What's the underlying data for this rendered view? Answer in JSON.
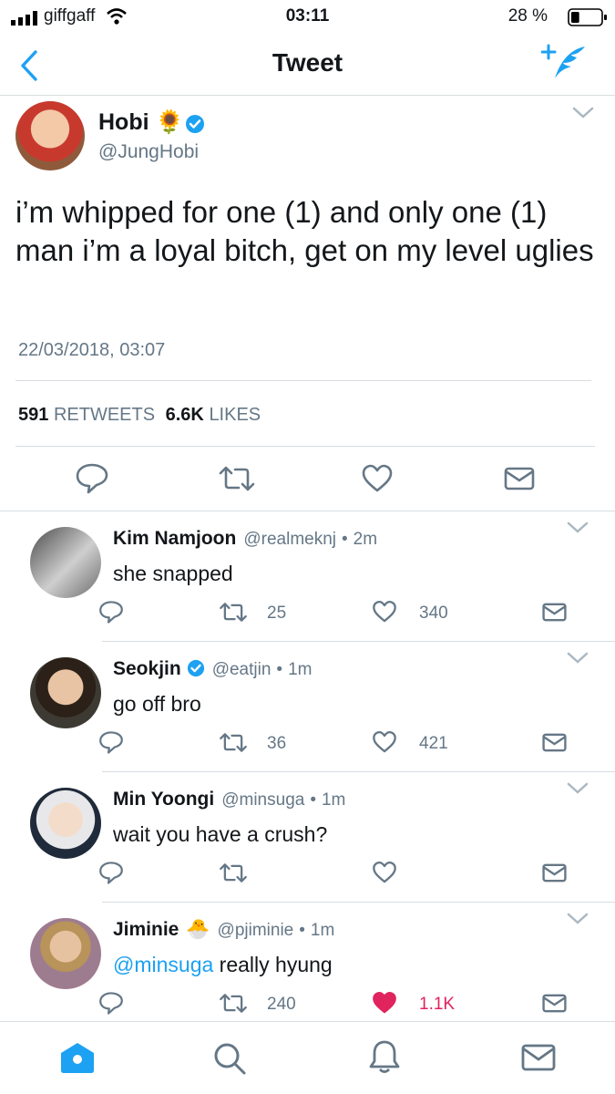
{
  "status_bar": {
    "carrier": "giffgaff",
    "time": "03:11",
    "battery": "28 %",
    "battery_level": 0.28
  },
  "nav": {
    "title": "Tweet",
    "back_icon": "chevron-left-icon",
    "compose_icon": "compose-tweet-icon",
    "accent_color": "#1da1f2"
  },
  "main_tweet": {
    "name": "Hobi",
    "name_emoji": "🌻",
    "handle": "@JungHobi",
    "text_line1": "i’m whipped for one (1) and only one (1)",
    "text_line2": "man i’m a loyal bitch, get on my level uglies",
    "timestamp": "22/03/2018, 03:07",
    "retweets_count": "591",
    "retweets_label": "RETWEETS",
    "likes_count": "6.6K",
    "likes_label": "LIKES"
  },
  "replies": [
    {
      "name": "Kim Namjoon",
      "handle": "@realmeknj",
      "time": "2m",
      "text": "she snapped",
      "retweets": "25",
      "likes": "340",
      "liked": false
    },
    {
      "name": "Seokjin",
      "verified": true,
      "handle": "@eatjin",
      "time": "1m",
      "text": "go off bro",
      "retweets": "36",
      "likes": "421",
      "liked": false
    },
    {
      "name": "Min Yoongi",
      "handle": "@minsuga",
      "time": "1m",
      "text": "wait you have a crush?",
      "retweets": "",
      "likes": "",
      "liked": false
    },
    {
      "name": "Jiminie",
      "name_emoji": "🐣",
      "handle": "@pjiminie",
      "time": "1m",
      "mention": "@minsuga",
      "text": " really hyung",
      "retweets": "240",
      "likes": "1.1K",
      "liked": true,
      "liked_color": "#e0245e"
    }
  ],
  "separator": "•",
  "tab_bar": {
    "tabs": [
      "home-icon",
      "search-icon",
      "notifications-icon",
      "messages-icon"
    ]
  }
}
